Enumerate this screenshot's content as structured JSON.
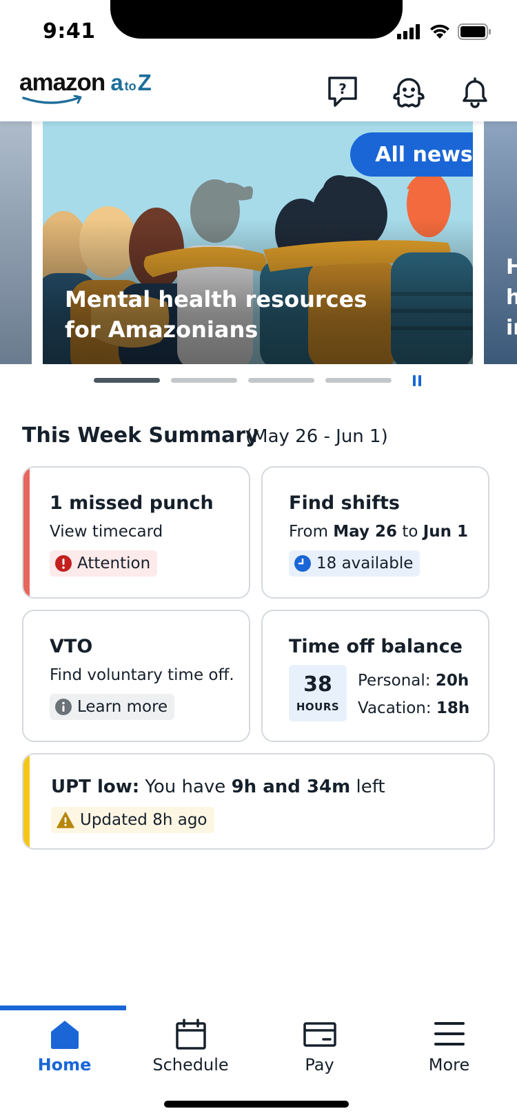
{
  "status_bar": {
    "time": "9:41"
  },
  "header": {
    "logo_word": "amazon",
    "logo_a": "a",
    "logo_to": "to",
    "logo_z": "Z",
    "icons": [
      "help-chat-icon",
      "ghost-mascot-icon",
      "bell-icon"
    ]
  },
  "carousel": {
    "slide_title": "Mental health resources for Amazonians",
    "all_news_label": "All news",
    "peek_right_text": "H h ir",
    "page_count": 4,
    "active_page": 1
  },
  "summary": {
    "title": "This Week Summary",
    "range": "(May 26 - Jun 1)"
  },
  "cards": {
    "missed_punch": {
      "title": "1 missed punch",
      "subtitle": "View timecard",
      "badge": "Attention",
      "accent": "#e8665d"
    },
    "find_shifts": {
      "title": "Find shifts",
      "from_word": "From",
      "from_date": "May 26",
      "to_word": "to",
      "to_date": "Jun 1",
      "badge": "18 available"
    },
    "vto": {
      "title": "VTO",
      "subtitle": "Find voluntary time off.",
      "badge": "Learn more"
    },
    "time_off": {
      "title": "Time off balance",
      "total": "38",
      "unit": "HOURS",
      "personal_label": "Personal:",
      "personal_value": "20h",
      "vacation_label": "Vacation:",
      "vacation_value": "18h"
    },
    "upt": {
      "label": "UPT low:",
      "text_before": "You have",
      "amount": "9h and 34m",
      "text_after": "left",
      "badge": "Updated 8h ago",
      "accent": "#f5c518"
    }
  },
  "tabbar": {
    "tabs": [
      {
        "label": "Home",
        "icon": "home-icon",
        "active": true
      },
      {
        "label": "Schedule",
        "icon": "calendar-icon",
        "active": false
      },
      {
        "label": "Pay",
        "icon": "credit-card-icon",
        "active": false
      },
      {
        "label": "More",
        "icon": "hamburger-menu-icon",
        "active": false
      }
    ]
  },
  "colors": {
    "accent_blue": "#1a66d6",
    "attention_red": "#e8665d",
    "warning_yellow": "#f5c518"
  }
}
